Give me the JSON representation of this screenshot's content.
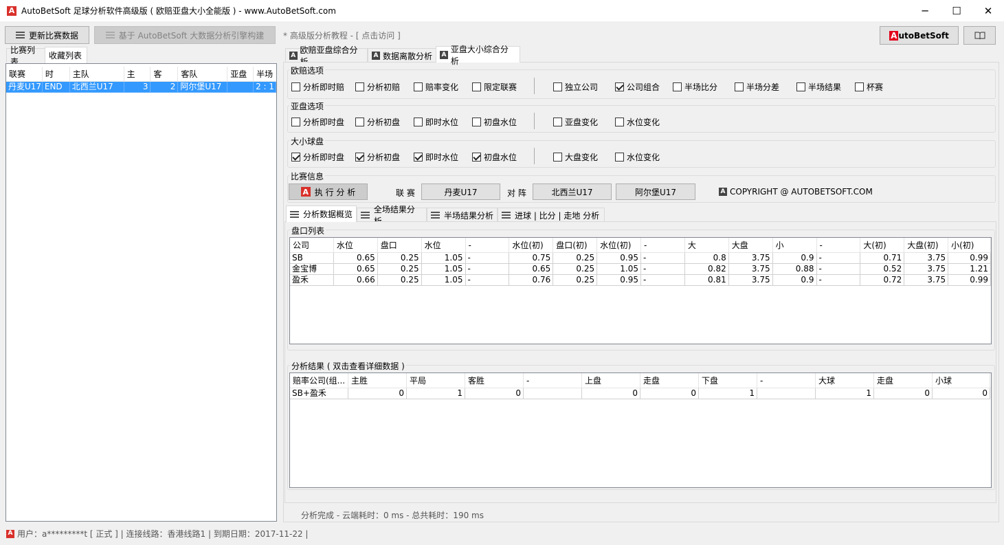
{
  "window": {
    "title": "AutoBetSoft 足球分析软件高级版 ( 欧赔亚盘大小全能版 ) -  www.AutoBetSoft.com",
    "logo_letter": "A",
    "minimize": "─",
    "maximize": "☐",
    "close": "✕"
  },
  "toolbar": {
    "update_label": "更新比赛数据",
    "engine_label": "基于 AutoBetSoft 大数据分析引擎构建",
    "tutorial_link": "* 高级版分析教程 - [ 点击访问 ]",
    "brand_first": "A",
    "brand_rest": "utoBetSoft",
    "book_icon": "book-icon"
  },
  "left": {
    "tabs": [
      "比赛列表",
      "收藏列表"
    ],
    "columns": [
      "联赛",
      "时",
      "主队",
      "主",
      "客",
      "客队",
      "亚盘",
      "半场"
    ],
    "rows": [
      [
        "丹麦U17",
        "END",
        "北西兰U17",
        "3",
        "2",
        "阿尔堡U17",
        "",
        "2 : 1"
      ]
    ]
  },
  "right": {
    "tabs": [
      "欧赔亚盘综合分析",
      "数据离散分析",
      "亚盘大小综合分析"
    ],
    "euro": {
      "title": "欧赔选项",
      "options": [
        {
          "label": "分析即时赔",
          "checked": false
        },
        {
          "label": "分析初赔",
          "checked": false
        },
        {
          "label": "赔率变化",
          "checked": false
        },
        {
          "label": "限定联赛",
          "checked": false
        },
        {
          "label": "独立公司",
          "checked": false
        },
        {
          "label": "公司组合",
          "checked": true
        },
        {
          "label": "半场比分",
          "checked": false
        },
        {
          "label": "半场分差",
          "checked": false
        },
        {
          "label": "半场结果",
          "checked": false
        },
        {
          "label": "杯赛",
          "checked": false
        }
      ]
    },
    "asian": {
      "title": "亚盘选项",
      "options": [
        {
          "label": "分析即时盘",
          "checked": false
        },
        {
          "label": "分析初盘",
          "checked": false
        },
        {
          "label": "即时水位",
          "checked": false
        },
        {
          "label": "初盘水位",
          "checked": false
        },
        {
          "label": "亚盘变化",
          "checked": false
        },
        {
          "label": "水位变化",
          "checked": false
        }
      ]
    },
    "ou": {
      "title": "大小球盘",
      "options": [
        {
          "label": "分析即时盘",
          "checked": true
        },
        {
          "label": "分析初盘",
          "checked": true
        },
        {
          "label": "即时水位",
          "checked": true
        },
        {
          "label": "初盘水位",
          "checked": true
        },
        {
          "label": "大盘变化",
          "checked": false
        },
        {
          "label": "水位变化",
          "checked": false
        }
      ]
    },
    "match": {
      "title": "比赛信息",
      "run_label": "执 行 分 析",
      "league_label": "联 赛",
      "league": "丹麦U17",
      "vs_label": "对 阵",
      "home": "北西兰U17",
      "away": "阿尔堡U17",
      "copyright": "COPYRIGHT @ AUTOBETSOFT.COM"
    },
    "subtabs": [
      "分析数据概览",
      "全场结果分析",
      "半场结果分析",
      "进球 | 比分 | 走地 分析"
    ],
    "odds": {
      "title": "盘口列表",
      "columns": [
        "公司",
        "水位",
        "盘口",
        "水位",
        "-",
        "水位(初)",
        "盘口(初)",
        "水位(初)",
        "-",
        "大",
        "大盘",
        "小",
        "-",
        "大(初)",
        "大盘(初)",
        "小(初)"
      ],
      "rows": [
        [
          "SB",
          "0.65",
          "0.25",
          "1.05",
          "-",
          "0.75",
          "0.25",
          "0.95",
          "-",
          "0.8",
          "3.75",
          "0.9",
          "-",
          "0.71",
          "3.75",
          "0.99"
        ],
        [
          "金宝博",
          "0.65",
          "0.25",
          "1.05",
          "-",
          "0.65",
          "0.25",
          "1.05",
          "-",
          "0.82",
          "3.75",
          "0.88",
          "-",
          "0.52",
          "3.75",
          "1.21"
        ],
        [
          "盈禾",
          "0.66",
          "0.25",
          "1.05",
          "-",
          "0.76",
          "0.25",
          "0.95",
          "-",
          "0.81",
          "3.75",
          "0.9",
          "-",
          "0.72",
          "3.75",
          "0.99"
        ]
      ]
    },
    "result": {
      "title": "分析结果 (  双击查看详细数据  )",
      "columns": [
        "赔率公司(组...",
        "主胜",
        "平局",
        "客胜",
        "-",
        "上盘",
        "走盘",
        "下盘",
        "-",
        "大球",
        "走盘",
        "小球"
      ],
      "rows": [
        [
          "SB+盈禾",
          "0",
          "1",
          "0",
          "",
          "0",
          "0",
          "1",
          "",
          "1",
          "0",
          "0"
        ]
      ]
    },
    "status": "分析完成 -  云端耗时：0 ms  - 总共耗时：190 ms"
  },
  "statusbar": {
    "text": "用户：a*********t [ 正式 ] | 连接线路：香港线路1 | 到期日期：2017-11-22  |"
  }
}
